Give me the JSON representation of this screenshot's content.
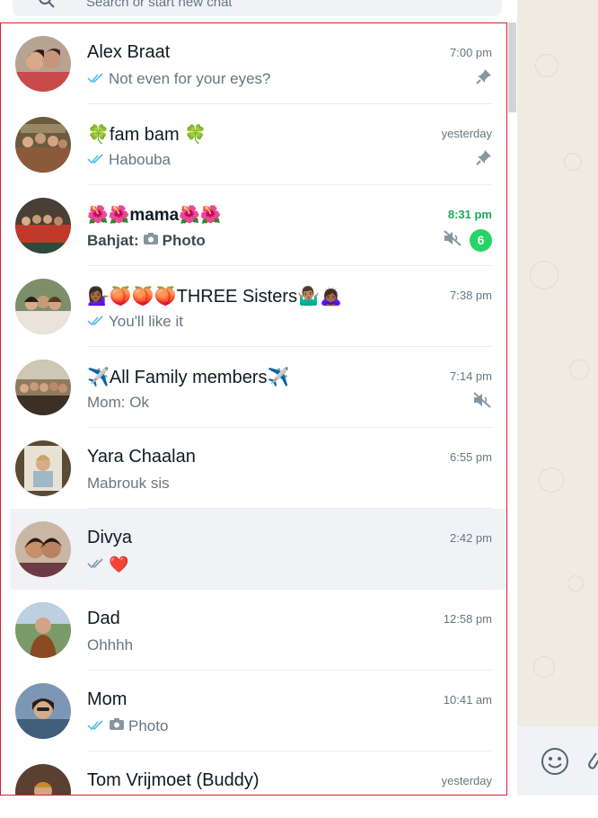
{
  "search": {
    "placeholder": "Search or start new chat"
  },
  "chats": [
    {
      "name": "Alex Braat",
      "time": "7:00 pm",
      "ticks": "read",
      "preview_text": "Not even for your eyes?",
      "pinned": true
    },
    {
      "name": "🍀fam bam 🍀",
      "time": "yesterday",
      "ticks": "read",
      "preview_text": "Habouba",
      "pinned": true
    },
    {
      "name": "🌺🌺mama🌺🌺",
      "time": "8:31 pm",
      "sender": "Bahjat:",
      "preview_text": "Photo",
      "muted": true,
      "unread_count": "6"
    },
    {
      "name": "💁🏾‍♀️🍑🍑🍑THREE Sisters🤷🏽‍♂️🙇🏾‍♀️",
      "time": "7:38 pm",
      "ticks": "read",
      "preview_text": "You'll like it"
    },
    {
      "name": "✈️All Family members✈️",
      "time": "7:14 pm",
      "preview_text": "Mom: Ok",
      "muted": true
    },
    {
      "name": "Yara Chaalan",
      "time": "6:55 pm",
      "preview_text": "Mabrouk sis"
    },
    {
      "name": "Divya",
      "time": "2:42 pm",
      "ticks": "delivered",
      "preview_text": "❤️",
      "selected": true
    },
    {
      "name": "Dad",
      "time": "12:58 pm",
      "preview_text": "Ohhhh"
    },
    {
      "name": "Mom",
      "time": "10:41 am",
      "ticks": "read",
      "preview_text": "Photo"
    },
    {
      "name": "Tom Vrijmoet (Buddy)",
      "time": "yesterday",
      "preview_text": ""
    }
  ],
  "colors": {
    "read_ticks": "#53bdeb",
    "delivered_ticks": "#8696a0",
    "unread_time": "#1fa855",
    "badge": "#25d366",
    "selection_border": "#d6212f",
    "chat_background": "#efeae2"
  },
  "icons": [
    "search-icon",
    "double-check-icon",
    "pin-icon",
    "camera-icon",
    "muted-speaker-icon",
    "emoji-icon",
    "attach-icon"
  ]
}
